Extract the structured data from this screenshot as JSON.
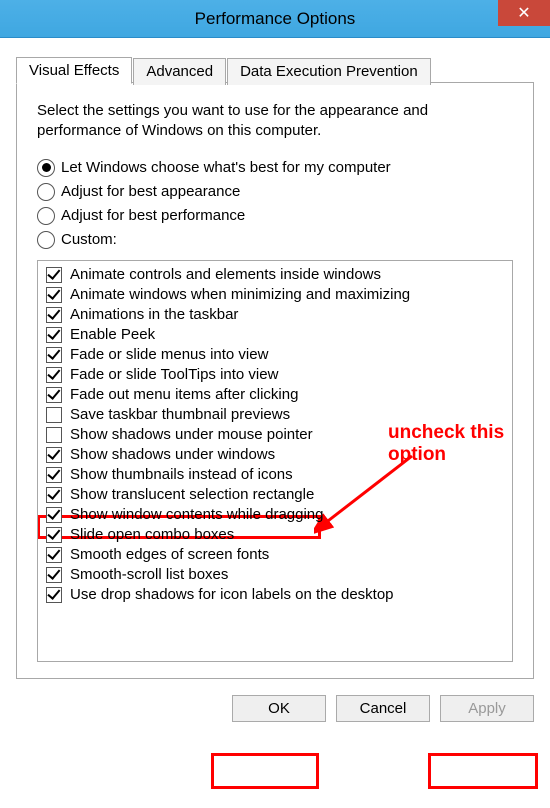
{
  "window": {
    "title": "Performance Options"
  },
  "tabs": {
    "visual_effects": "Visual Effects",
    "advanced": "Advanced",
    "dep": "Data Execution Prevention"
  },
  "description": "Select the settings you want to use for the appearance and performance of Windows on this computer.",
  "radios": {
    "auto": "Let Windows choose what's best for my computer",
    "best_appearance": "Adjust for best appearance",
    "best_performance": "Adjust for best performance",
    "custom": "Custom:"
  },
  "checkboxes": [
    {
      "label": "Animate controls and elements inside windows",
      "checked": true
    },
    {
      "label": "Animate windows when minimizing and maximizing",
      "checked": true
    },
    {
      "label": "Animations in the taskbar",
      "checked": true
    },
    {
      "label": "Enable Peek",
      "checked": true
    },
    {
      "label": "Fade or slide menus into view",
      "checked": true
    },
    {
      "label": "Fade or slide ToolTips into view",
      "checked": true
    },
    {
      "label": "Fade out menu items after clicking",
      "checked": true
    },
    {
      "label": "Save taskbar thumbnail previews",
      "checked": false
    },
    {
      "label": "Show shadows under mouse pointer",
      "checked": false
    },
    {
      "label": "Show shadows under windows",
      "checked": true
    },
    {
      "label": "Show thumbnails instead of icons",
      "checked": true
    },
    {
      "label": "Show translucent selection rectangle",
      "checked": true
    },
    {
      "label": "Show window contents while dragging",
      "checked": true
    },
    {
      "label": "Slide open combo boxes",
      "checked": true
    },
    {
      "label": "Smooth edges of screen fonts",
      "checked": true
    },
    {
      "label": "Smooth-scroll list boxes",
      "checked": true
    },
    {
      "label": "Use drop shadows for icon labels on the desktop",
      "checked": true
    }
  ],
  "buttons": {
    "ok": "OK",
    "cancel": "Cancel",
    "apply": "Apply"
  },
  "annotation": {
    "text": "uncheck this option"
  }
}
